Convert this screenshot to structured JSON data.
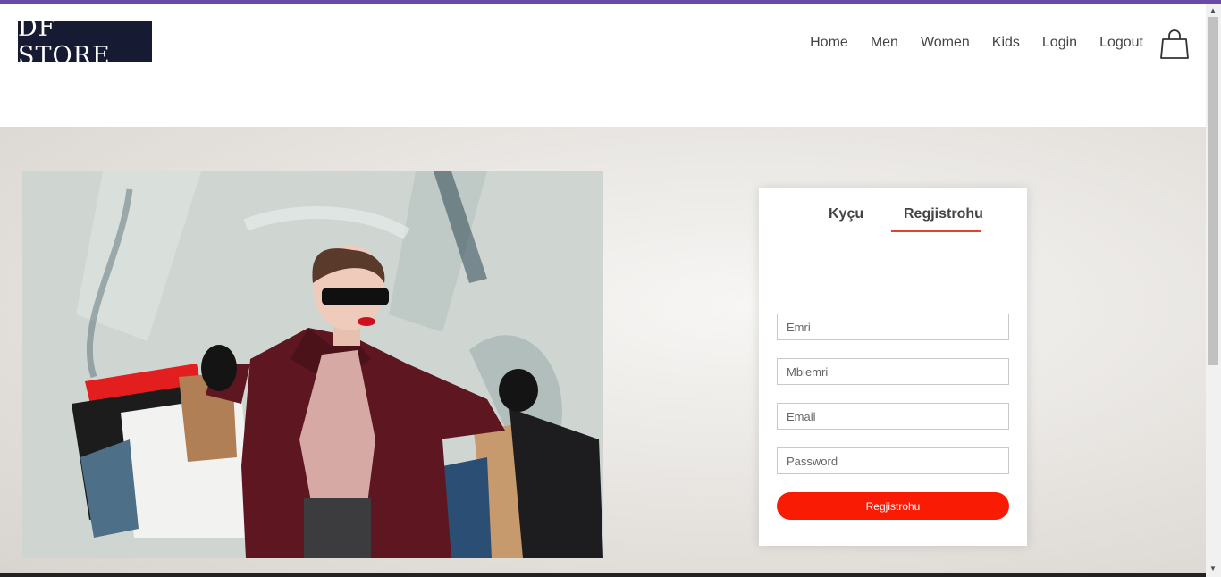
{
  "brand": {
    "logo_text": "DF STORE"
  },
  "nav": {
    "items": [
      "Home",
      "Men",
      "Women",
      "Kids",
      "Login",
      "Logout"
    ]
  },
  "auth": {
    "tabs": {
      "login": "Kyçu",
      "register": "Regjistrohu"
    },
    "active_tab": "register",
    "fields": {
      "first_name": {
        "placeholder": "Emri",
        "value": ""
      },
      "last_name": {
        "placeholder": "Mbiemri",
        "value": ""
      },
      "email": {
        "placeholder": "Email",
        "value": ""
      },
      "password": {
        "placeholder": "Password",
        "value": ""
      }
    },
    "submit_label": "Regjistrohu"
  },
  "colors": {
    "accent_bar": "#6a4aa8",
    "button": "#fa1b05",
    "tab_underline": "#e0442a",
    "logo_bg": "#161a33"
  },
  "icons": {
    "cart": "shopping-bag-icon"
  }
}
